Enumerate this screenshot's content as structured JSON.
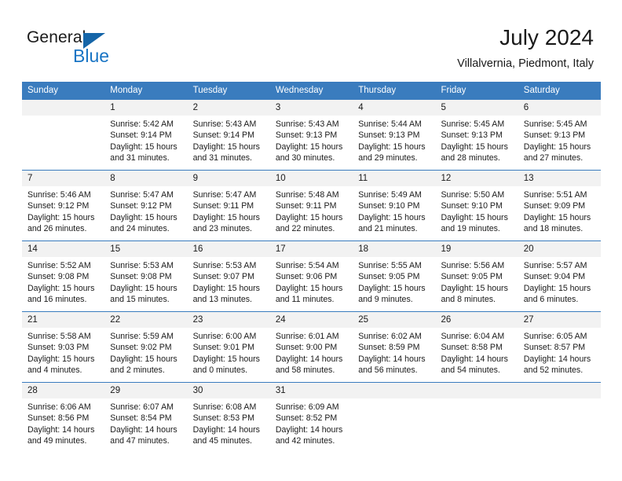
{
  "brand": {
    "name_part1": "General",
    "name_part2": "Blue",
    "accent_color": "#1874c4"
  },
  "header": {
    "title": "July 2024",
    "subtitle": "Villalvernia, Piedmont, Italy"
  },
  "theme": {
    "header_band": "#3a7cbe",
    "daynum_band": "#f2f2f2",
    "text": "#1a1a1a"
  },
  "weekday_headers": [
    "Sunday",
    "Monday",
    "Tuesday",
    "Wednesday",
    "Thursday",
    "Friday",
    "Saturday"
  ],
  "weeks": [
    [
      {
        "day": "",
        "sunrise": "",
        "sunset": "",
        "daylight1": "",
        "daylight2": "",
        "blank": true
      },
      {
        "day": "1",
        "sunrise": "Sunrise: 5:42 AM",
        "sunset": "Sunset: 9:14 PM",
        "daylight1": "Daylight: 15 hours",
        "daylight2": "and 31 minutes."
      },
      {
        "day": "2",
        "sunrise": "Sunrise: 5:43 AM",
        "sunset": "Sunset: 9:14 PM",
        "daylight1": "Daylight: 15 hours",
        "daylight2": "and 31 minutes."
      },
      {
        "day": "3",
        "sunrise": "Sunrise: 5:43 AM",
        "sunset": "Sunset: 9:13 PM",
        "daylight1": "Daylight: 15 hours",
        "daylight2": "and 30 minutes."
      },
      {
        "day": "4",
        "sunrise": "Sunrise: 5:44 AM",
        "sunset": "Sunset: 9:13 PM",
        "daylight1": "Daylight: 15 hours",
        "daylight2": "and 29 minutes."
      },
      {
        "day": "5",
        "sunrise": "Sunrise: 5:45 AM",
        "sunset": "Sunset: 9:13 PM",
        "daylight1": "Daylight: 15 hours",
        "daylight2": "and 28 minutes."
      },
      {
        "day": "6",
        "sunrise": "Sunrise: 5:45 AM",
        "sunset": "Sunset: 9:13 PM",
        "daylight1": "Daylight: 15 hours",
        "daylight2": "and 27 minutes."
      }
    ],
    [
      {
        "day": "7",
        "sunrise": "Sunrise: 5:46 AM",
        "sunset": "Sunset: 9:12 PM",
        "daylight1": "Daylight: 15 hours",
        "daylight2": "and 26 minutes."
      },
      {
        "day": "8",
        "sunrise": "Sunrise: 5:47 AM",
        "sunset": "Sunset: 9:12 PM",
        "daylight1": "Daylight: 15 hours",
        "daylight2": "and 24 minutes."
      },
      {
        "day": "9",
        "sunrise": "Sunrise: 5:47 AM",
        "sunset": "Sunset: 9:11 PM",
        "daylight1": "Daylight: 15 hours",
        "daylight2": "and 23 minutes."
      },
      {
        "day": "10",
        "sunrise": "Sunrise: 5:48 AM",
        "sunset": "Sunset: 9:11 PM",
        "daylight1": "Daylight: 15 hours",
        "daylight2": "and 22 minutes."
      },
      {
        "day": "11",
        "sunrise": "Sunrise: 5:49 AM",
        "sunset": "Sunset: 9:10 PM",
        "daylight1": "Daylight: 15 hours",
        "daylight2": "and 21 minutes."
      },
      {
        "day": "12",
        "sunrise": "Sunrise: 5:50 AM",
        "sunset": "Sunset: 9:10 PM",
        "daylight1": "Daylight: 15 hours",
        "daylight2": "and 19 minutes."
      },
      {
        "day": "13",
        "sunrise": "Sunrise: 5:51 AM",
        "sunset": "Sunset: 9:09 PM",
        "daylight1": "Daylight: 15 hours",
        "daylight2": "and 18 minutes."
      }
    ],
    [
      {
        "day": "14",
        "sunrise": "Sunrise: 5:52 AM",
        "sunset": "Sunset: 9:08 PM",
        "daylight1": "Daylight: 15 hours",
        "daylight2": "and 16 minutes."
      },
      {
        "day": "15",
        "sunrise": "Sunrise: 5:53 AM",
        "sunset": "Sunset: 9:08 PM",
        "daylight1": "Daylight: 15 hours",
        "daylight2": "and 15 minutes."
      },
      {
        "day": "16",
        "sunrise": "Sunrise: 5:53 AM",
        "sunset": "Sunset: 9:07 PM",
        "daylight1": "Daylight: 15 hours",
        "daylight2": "and 13 minutes."
      },
      {
        "day": "17",
        "sunrise": "Sunrise: 5:54 AM",
        "sunset": "Sunset: 9:06 PM",
        "daylight1": "Daylight: 15 hours",
        "daylight2": "and 11 minutes."
      },
      {
        "day": "18",
        "sunrise": "Sunrise: 5:55 AM",
        "sunset": "Sunset: 9:05 PM",
        "daylight1": "Daylight: 15 hours",
        "daylight2": "and 9 minutes."
      },
      {
        "day": "19",
        "sunrise": "Sunrise: 5:56 AM",
        "sunset": "Sunset: 9:05 PM",
        "daylight1": "Daylight: 15 hours",
        "daylight2": "and 8 minutes."
      },
      {
        "day": "20",
        "sunrise": "Sunrise: 5:57 AM",
        "sunset": "Sunset: 9:04 PM",
        "daylight1": "Daylight: 15 hours",
        "daylight2": "and 6 minutes."
      }
    ],
    [
      {
        "day": "21",
        "sunrise": "Sunrise: 5:58 AM",
        "sunset": "Sunset: 9:03 PM",
        "daylight1": "Daylight: 15 hours",
        "daylight2": "and 4 minutes."
      },
      {
        "day": "22",
        "sunrise": "Sunrise: 5:59 AM",
        "sunset": "Sunset: 9:02 PM",
        "daylight1": "Daylight: 15 hours",
        "daylight2": "and 2 minutes."
      },
      {
        "day": "23",
        "sunrise": "Sunrise: 6:00 AM",
        "sunset": "Sunset: 9:01 PM",
        "daylight1": "Daylight: 15 hours",
        "daylight2": "and 0 minutes."
      },
      {
        "day": "24",
        "sunrise": "Sunrise: 6:01 AM",
        "sunset": "Sunset: 9:00 PM",
        "daylight1": "Daylight: 14 hours",
        "daylight2": "and 58 minutes."
      },
      {
        "day": "25",
        "sunrise": "Sunrise: 6:02 AM",
        "sunset": "Sunset: 8:59 PM",
        "daylight1": "Daylight: 14 hours",
        "daylight2": "and 56 minutes."
      },
      {
        "day": "26",
        "sunrise": "Sunrise: 6:04 AM",
        "sunset": "Sunset: 8:58 PM",
        "daylight1": "Daylight: 14 hours",
        "daylight2": "and 54 minutes."
      },
      {
        "day": "27",
        "sunrise": "Sunrise: 6:05 AM",
        "sunset": "Sunset: 8:57 PM",
        "daylight1": "Daylight: 14 hours",
        "daylight2": "and 52 minutes."
      }
    ],
    [
      {
        "day": "28",
        "sunrise": "Sunrise: 6:06 AM",
        "sunset": "Sunset: 8:56 PM",
        "daylight1": "Daylight: 14 hours",
        "daylight2": "and 49 minutes."
      },
      {
        "day": "29",
        "sunrise": "Sunrise: 6:07 AM",
        "sunset": "Sunset: 8:54 PM",
        "daylight1": "Daylight: 14 hours",
        "daylight2": "and 47 minutes."
      },
      {
        "day": "30",
        "sunrise": "Sunrise: 6:08 AM",
        "sunset": "Sunset: 8:53 PM",
        "daylight1": "Daylight: 14 hours",
        "daylight2": "and 45 minutes."
      },
      {
        "day": "31",
        "sunrise": "Sunrise: 6:09 AM",
        "sunset": "Sunset: 8:52 PM",
        "daylight1": "Daylight: 14 hours",
        "daylight2": "and 42 minutes."
      },
      {
        "day": "",
        "sunrise": "",
        "sunset": "",
        "daylight1": "",
        "daylight2": "",
        "blank": true
      },
      {
        "day": "",
        "sunrise": "",
        "sunset": "",
        "daylight1": "",
        "daylight2": "",
        "blank": true
      },
      {
        "day": "",
        "sunrise": "",
        "sunset": "",
        "daylight1": "",
        "daylight2": "",
        "blank": true
      }
    ]
  ]
}
